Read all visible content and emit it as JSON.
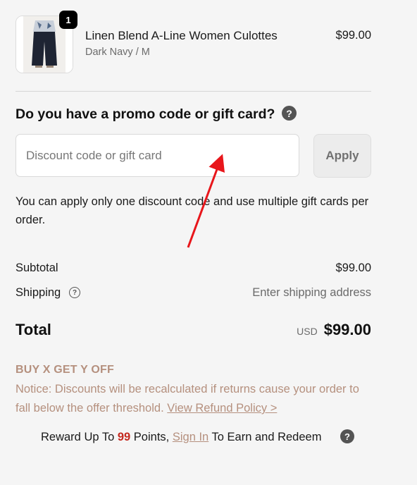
{
  "product": {
    "quantity": "1",
    "name": "Linen Blend A-Line Women Culottes",
    "variant": "Dark Navy / M",
    "price": "$99.00",
    "thumbnail_icon": "product-thumbnail"
  },
  "promo": {
    "title": "Do you have a promo code or gift card?",
    "input_placeholder": "Discount code or gift card",
    "input_value": "",
    "apply_label": "Apply",
    "note": "You can apply only one discount code and use multiple gift cards per order."
  },
  "summary": {
    "subtotal_label": "Subtotal",
    "subtotal_value": "$99.00",
    "shipping_label": "Shipping",
    "shipping_value": "Enter shipping address",
    "total_label": "Total",
    "currency": "USD",
    "total_value": "$99.00"
  },
  "offer": {
    "title": "BUY X GET Y OFF",
    "notice": "Notice: Discounts will be recalculated if returns cause your order to fall below the offer threshold.",
    "refund_link": "View Refund Policy >"
  },
  "reward": {
    "prefix": "Reward Up To",
    "points": "99",
    "middle": "Points,",
    "sign_in": "Sign In",
    "suffix": "To Earn and Redeem"
  },
  "colors": {
    "background": "#f5f5f5",
    "offer_text": "#b5907e",
    "points_red": "#c4291f",
    "annotation_arrow": "#e8161b"
  }
}
